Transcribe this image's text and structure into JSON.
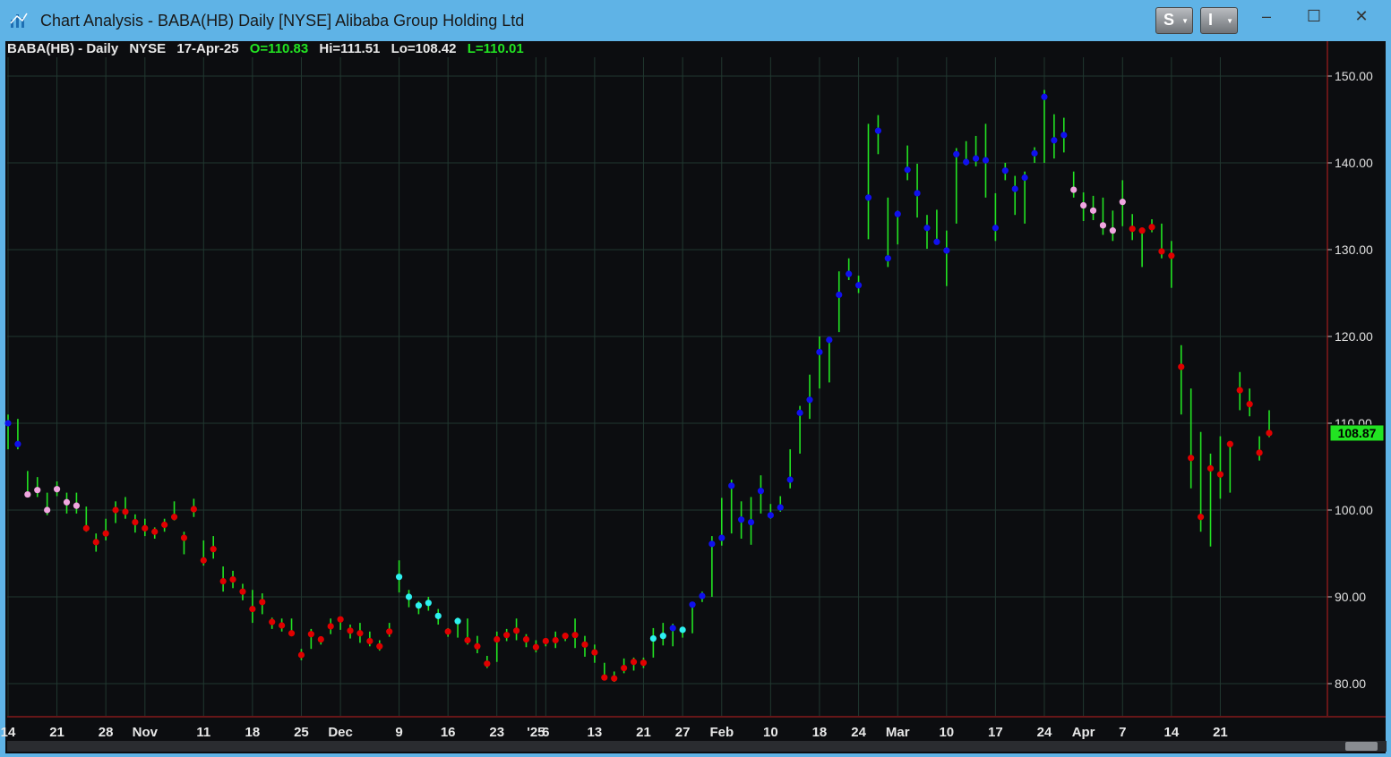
{
  "window": {
    "title": "Chart Analysis - BABA(HB) Daily [NYSE] Alibaba Group Holding Ltd",
    "buttons": [
      {
        "label": "S"
      },
      {
        "label": "I"
      }
    ],
    "controls": {
      "minimize": "–",
      "maximize": "☐",
      "close": "✕"
    }
  },
  "header": {
    "symbol": "BABA(HB) - Daily",
    "exchange": "NYSE",
    "date": "17-Apr-25",
    "open": "O=110.83",
    "high": "Hi=111.51",
    "low": "Lo=108.42",
    "last": "L=110.01"
  },
  "colors": {
    "background": "#0c0d10",
    "grid": "#213830",
    "bar": "#22e322",
    "dot_red": "#e00000",
    "dot_pink": "#f0a6e0",
    "dot_cyan": "#2ef0f0",
    "dot_blue": "#1010ee",
    "price_label_bg": "#22e322"
  },
  "chart_data": {
    "type": "line",
    "ylim": [
      77,
      153
    ],
    "y_ticks": [
      80,
      90,
      100,
      110,
      120,
      130,
      140,
      150
    ],
    "y_tick_labels": [
      "80.00",
      "90.00",
      "100.00",
      "110.00",
      "120.00",
      "130.00",
      "140.00",
      "150.00"
    ],
    "last_price_label": "108.87",
    "last_price": 108.87,
    "x_tick_labels": [
      "14",
      "21",
      "28",
      "Nov",
      "11",
      "18",
      "25",
      "Dec",
      "9",
      "16",
      "23",
      "'25",
      "6",
      "13",
      "21",
      "27",
      "Feb",
      "10",
      "18",
      "24",
      "Mar",
      "10",
      "17",
      "24",
      "Apr",
      "7",
      "14",
      "21"
    ],
    "x_tick_index": [
      0,
      5,
      10,
      14,
      20,
      25,
      30,
      34,
      40,
      45,
      50,
      54,
      55,
      60,
      65,
      69,
      73,
      78,
      83,
      87,
      91,
      96,
      101,
      106,
      110,
      114,
      119,
      124
    ],
    "points": [
      {
        "h": 111,
        "l": 107,
        "c": 110,
        "s": "b"
      },
      {
        "h": 110.5,
        "l": 107,
        "c": 107.6,
        "s": "b"
      },
      {
        "h": 104.5,
        "l": 101.5,
        "c": 101.8,
        "s": "p"
      },
      {
        "h": 103.8,
        "l": 101.5,
        "c": 102.3,
        "s": "p"
      },
      {
        "h": 102,
        "l": 99.4,
        "c": 100,
        "s": "p"
      },
      {
        "h": 103.3,
        "l": 101.6,
        "c": 102.4,
        "s": "p"
      },
      {
        "h": 102,
        "l": 99.6,
        "c": 100.9,
        "s": "p"
      },
      {
        "h": 102,
        "l": 99.6,
        "c": 100.5,
        "s": "p"
      },
      {
        "h": 100.4,
        "l": 97.5,
        "c": 97.9,
        "s": "r"
      },
      {
        "h": 97.3,
        "l": 95.2,
        "c": 96.3,
        "s": "r"
      },
      {
        "h": 99,
        "l": 96.5,
        "c": 97.3,
        "s": "r"
      },
      {
        "h": 101,
        "l": 98.5,
        "c": 100,
        "s": "r"
      },
      {
        "h": 101.5,
        "l": 99,
        "c": 99.8,
        "s": "r"
      },
      {
        "h": 99.5,
        "l": 97.4,
        "c": 98.6,
        "s": "r"
      },
      {
        "h": 99,
        "l": 97,
        "c": 97.9,
        "s": "r"
      },
      {
        "h": 98,
        "l": 96.7,
        "c": 97.5,
        "s": "r"
      },
      {
        "h": 99,
        "l": 97.5,
        "c": 98.3,
        "s": "r"
      },
      {
        "h": 101,
        "l": 98.8,
        "c": 99.2,
        "s": "r"
      },
      {
        "h": 97.5,
        "l": 94.9,
        "c": 96.8,
        "s": "r"
      },
      {
        "h": 101.3,
        "l": 99.2,
        "c": 100.1,
        "s": "r"
      },
      {
        "h": 96.5,
        "l": 93.6,
        "c": 94.2,
        "s": "r"
      },
      {
        "h": 97,
        "l": 94.4,
        "c": 95.5,
        "s": "r"
      },
      {
        "h": 93.5,
        "l": 90.6,
        "c": 91.8,
        "s": "r"
      },
      {
        "h": 93,
        "l": 91,
        "c": 92,
        "s": "r"
      },
      {
        "h": 91.5,
        "l": 89.6,
        "c": 90.6,
        "s": "r"
      },
      {
        "h": 90.8,
        "l": 87,
        "c": 88.6,
        "s": "r"
      },
      {
        "h": 90.4,
        "l": 88,
        "c": 89.4,
        "s": "r"
      },
      {
        "h": 87.6,
        "l": 86.3,
        "c": 87.1,
        "s": "r"
      },
      {
        "h": 87.5,
        "l": 86,
        "c": 86.7,
        "s": "r"
      },
      {
        "h": 87.5,
        "l": 85.6,
        "c": 85.8,
        "s": "r"
      },
      {
        "h": 84,
        "l": 82.7,
        "c": 83.3,
        "s": "r"
      },
      {
        "h": 86.3,
        "l": 84,
        "c": 85.7,
        "s": "r"
      },
      {
        "h": 85.4,
        "l": 84.5,
        "c": 85.1,
        "s": "r"
      },
      {
        "h": 87.5,
        "l": 85.7,
        "c": 86.6,
        "s": "r"
      },
      {
        "h": 87.6,
        "l": 86.2,
        "c": 87.4,
        "s": "r"
      },
      {
        "h": 86.8,
        "l": 85.2,
        "c": 86.1,
        "s": "r"
      },
      {
        "h": 87,
        "l": 84.7,
        "c": 85.8,
        "s": "r"
      },
      {
        "h": 86,
        "l": 84.3,
        "c": 84.9,
        "s": "r"
      },
      {
        "h": 85,
        "l": 83.8,
        "c": 84.3,
        "s": "r"
      },
      {
        "h": 87,
        "l": 85.4,
        "c": 86,
        "s": "r"
      },
      {
        "h": 94.2,
        "l": 90.5,
        "c": 92.3,
        "s": "c"
      },
      {
        "h": 90.8,
        "l": 88.8,
        "c": 90,
        "s": "c"
      },
      {
        "h": 89.5,
        "l": 88,
        "c": 89,
        "s": "c"
      },
      {
        "h": 90,
        "l": 88.4,
        "c": 89.3,
        "s": "c"
      },
      {
        "h": 88.6,
        "l": 86.8,
        "c": 87.8,
        "s": "c"
      },
      {
        "h": 86.4,
        "l": 85.4,
        "c": 86,
        "s": "r"
      },
      {
        "h": 87.6,
        "l": 85.3,
        "c": 87.2,
        "s": "c"
      },
      {
        "h": 87.5,
        "l": 84.5,
        "c": 85,
        "s": "r"
      },
      {
        "h": 85.5,
        "l": 83.5,
        "c": 84.3,
        "s": "r"
      },
      {
        "h": 83.2,
        "l": 81.8,
        "c": 82.3,
        "s": "r"
      },
      {
        "h": 86,
        "l": 82.5,
        "c": 85.1,
        "s": "r"
      },
      {
        "h": 86.3,
        "l": 84.9,
        "c": 85.6,
        "s": "r"
      },
      {
        "h": 87.5,
        "l": 85,
        "c": 86.1,
        "s": "r"
      },
      {
        "h": 85.7,
        "l": 84.2,
        "c": 85.1,
        "s": "r"
      },
      {
        "h": 85,
        "l": 83.6,
        "c": 84.2,
        "s": "r"
      },
      {
        "h": 85.2,
        "l": 84.3,
        "c": 84.9,
        "s": "r"
      },
      {
        "h": 86,
        "l": 84.1,
        "c": 85,
        "s": "r"
      },
      {
        "h": 85.7,
        "l": 84.9,
        "c": 85.5,
        "s": "r"
      },
      {
        "h": 87.5,
        "l": 84.1,
        "c": 85.6,
        "s": "r"
      },
      {
        "h": 85.5,
        "l": 83.1,
        "c": 84.5,
        "s": "r"
      },
      {
        "h": 84.5,
        "l": 82.4,
        "c": 83.6,
        "s": "r"
      },
      {
        "h": 82.4,
        "l": 80.6,
        "c": 80.7,
        "s": "r"
      },
      {
        "h": 81.4,
        "l": 80.2,
        "c": 80.6,
        "s": "r"
      },
      {
        "h": 82.9,
        "l": 81.2,
        "c": 81.8,
        "s": "r"
      },
      {
        "h": 83,
        "l": 81.5,
        "c": 82.5,
        "s": "r"
      },
      {
        "h": 83,
        "l": 81.8,
        "c": 82.4,
        "s": "r"
      },
      {
        "h": 86.4,
        "l": 83,
        "c": 85.2,
        "s": "c"
      },
      {
        "h": 87,
        "l": 84.4,
        "c": 85.5,
        "s": "c"
      },
      {
        "h": 86.9,
        "l": 84.3,
        "c": 86.4,
        "s": "b"
      },
      {
        "h": 86.5,
        "l": 85.3,
        "c": 86.2,
        "s": "c"
      },
      {
        "h": 89,
        "l": 85.8,
        "c": 89.1,
        "s": "b"
      },
      {
        "h": 90.6,
        "l": 89.4,
        "c": 90.1,
        "s": "b"
      },
      {
        "h": 97,
        "l": 90,
        "c": 96.1,
        "s": "b"
      },
      {
        "h": 101.4,
        "l": 95.9,
        "c": 96.8,
        "s": "b"
      },
      {
        "h": 103.5,
        "l": 97.3,
        "c": 102.8,
        "s": "b"
      },
      {
        "h": 101,
        "l": 96.7,
        "c": 98.9,
        "s": "b"
      },
      {
        "h": 101.5,
        "l": 96,
        "c": 98.6,
        "s": "b"
      },
      {
        "h": 104,
        "l": 99.6,
        "c": 102.2,
        "s": "b"
      },
      {
        "h": 100.7,
        "l": 99,
        "c": 99.4,
        "s": "b"
      },
      {
        "h": 101.6,
        "l": 99.8,
        "c": 100.3,
        "s": "b"
      },
      {
        "h": 107,
        "l": 102.5,
        "c": 103.5,
        "s": "b"
      },
      {
        "h": 112,
        "l": 106.5,
        "c": 111.2,
        "s": "b"
      },
      {
        "h": 115.6,
        "l": 110.5,
        "c": 112.7,
        "s": "b"
      },
      {
        "h": 120,
        "l": 114,
        "c": 118.2,
        "s": "b"
      },
      {
        "h": 119.6,
        "l": 114.7,
        "c": 119.6,
        "s": "b"
      },
      {
        "h": 127.5,
        "l": 120.5,
        "c": 124.8,
        "s": "b"
      },
      {
        "h": 129,
        "l": 126.5,
        "c": 127.2,
        "s": "b"
      },
      {
        "h": 127,
        "l": 125,
        "c": 125.9,
        "s": "b"
      },
      {
        "h": 144.5,
        "l": 131.2,
        "c": 136,
        "s": "b"
      },
      {
        "h": 145.5,
        "l": 141,
        "c": 143.7,
        "s": "b"
      },
      {
        "h": 136,
        "l": 128,
        "c": 129,
        "s": "b"
      },
      {
        "h": 134.5,
        "l": 130.6,
        "c": 134.1,
        "s": "b"
      },
      {
        "h": 142,
        "l": 138,
        "c": 139.2,
        "s": "b"
      },
      {
        "h": 139.9,
        "l": 133.7,
        "c": 136.5,
        "s": "b"
      },
      {
        "h": 134,
        "l": 130.1,
        "c": 132.5,
        "s": "b"
      },
      {
        "h": 134.6,
        "l": 130.7,
        "c": 130.9,
        "s": "b"
      },
      {
        "h": 132.2,
        "l": 125.8,
        "c": 129.9,
        "s": "b"
      },
      {
        "h": 141.7,
        "l": 133,
        "c": 141,
        "s": "b"
      },
      {
        "h": 142.5,
        "l": 139.7,
        "c": 140.1,
        "s": "b"
      },
      {
        "h": 143.1,
        "l": 139.6,
        "c": 140.5,
        "s": "b"
      },
      {
        "h": 144.5,
        "l": 136,
        "c": 140.3,
        "s": "b"
      },
      {
        "h": 136.5,
        "l": 131,
        "c": 132.5,
        "s": "b"
      },
      {
        "h": 140,
        "l": 138,
        "c": 139.1,
        "s": "b"
      },
      {
        "h": 138.5,
        "l": 134,
        "c": 137,
        "s": "b"
      },
      {
        "h": 139,
        "l": 133,
        "c": 138.3,
        "s": "b"
      },
      {
        "h": 141.8,
        "l": 140,
        "c": 141.1,
        "s": "b"
      },
      {
        "h": 148.4,
        "l": 140,
        "c": 147.6,
        "s": "b"
      },
      {
        "h": 145.6,
        "l": 140.5,
        "c": 142.6,
        "s": "b"
      },
      {
        "h": 145.2,
        "l": 141.2,
        "c": 143.2,
        "s": "b"
      },
      {
        "h": 139,
        "l": 136,
        "c": 136.9,
        "s": "p"
      },
      {
        "h": 136.6,
        "l": 133.3,
        "c": 135.1,
        "s": "p"
      },
      {
        "h": 136.2,
        "l": 133.4,
        "c": 134.5,
        "s": "p"
      },
      {
        "h": 136,
        "l": 131.7,
        "c": 132.8,
        "s": "p"
      },
      {
        "h": 134.5,
        "l": 131,
        "c": 132.2,
        "s": "p"
      },
      {
        "h": 138,
        "l": 132.7,
        "c": 135.5,
        "s": "p"
      },
      {
        "h": 134.1,
        "l": 131.1,
        "c": 132.4,
        "s": "r"
      },
      {
        "h": 132.2,
        "l": 128,
        "c": 132.2,
        "s": "r"
      },
      {
        "h": 133.5,
        "l": 132,
        "c": 132.6,
        "s": "r"
      },
      {
        "h": 133,
        "l": 129,
        "c": 129.8,
        "s": "r"
      },
      {
        "h": 131,
        "l": 125.6,
        "c": 129.3,
        "s": "r"
      },
      {
        "h": 119,
        "l": 111,
        "c": 116.5,
        "s": "r"
      },
      {
        "h": 114,
        "l": 102.5,
        "c": 106,
        "s": "r"
      },
      {
        "h": 109,
        "l": 97.5,
        "c": 99.2,
        "s": "r"
      },
      {
        "h": 106.5,
        "l": 95.8,
        "c": 104.8,
        "s": "r"
      },
      {
        "h": 108.5,
        "l": 101.3,
        "c": 104.1,
        "s": "r"
      },
      {
        "h": 107.6,
        "l": 102,
        "c": 107.6,
        "s": "r"
      },
      {
        "h": 115.9,
        "l": 111.5,
        "c": 113.8,
        "s": "r"
      },
      {
        "h": 114,
        "l": 110.8,
        "c": 112.2,
        "s": "r"
      },
      {
        "h": 108.5,
        "l": 105.7,
        "c": 106.6,
        "s": "r"
      },
      {
        "h": 111.5,
        "l": 108.4,
        "c": 108.87,
        "s": "r"
      }
    ]
  }
}
